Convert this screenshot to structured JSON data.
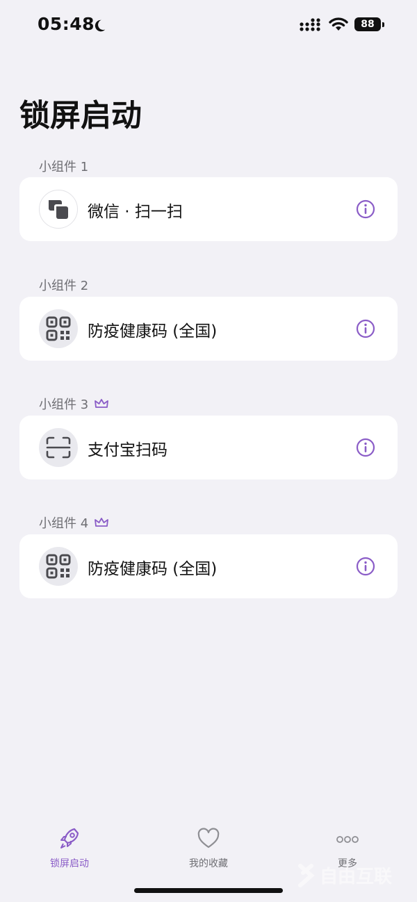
{
  "status_bar": {
    "time": "05:48",
    "battery": "88"
  },
  "page": {
    "title": "锁屏启动"
  },
  "widgets": [
    {
      "section": "小组件 1",
      "label": "微信 · 扫一扫",
      "icon": "wechat-scan-icon",
      "premium": false
    },
    {
      "section": "小组件 2",
      "label": "防疫健康码 (全国)",
      "icon": "qr-code-icon",
      "premium": false
    },
    {
      "section": "小组件 3",
      "label": "支付宝扫码",
      "icon": "scan-frame-icon",
      "premium": true
    },
    {
      "section": "小组件 4",
      "label": "防疫健康码 (全国)",
      "icon": "qr-code-icon",
      "premium": true
    }
  ],
  "tabs": [
    {
      "label": "锁屏启动",
      "icon": "rocket-icon",
      "active": true
    },
    {
      "label": "我的收藏",
      "icon": "heart-icon",
      "active": false
    },
    {
      "label": "更多",
      "icon": "more-dots-icon",
      "active": false
    }
  ],
  "watermark": "自由互联",
  "colors": {
    "accent": "#8a5cc7",
    "background": "#f2f1f6",
    "card": "#ffffff"
  }
}
